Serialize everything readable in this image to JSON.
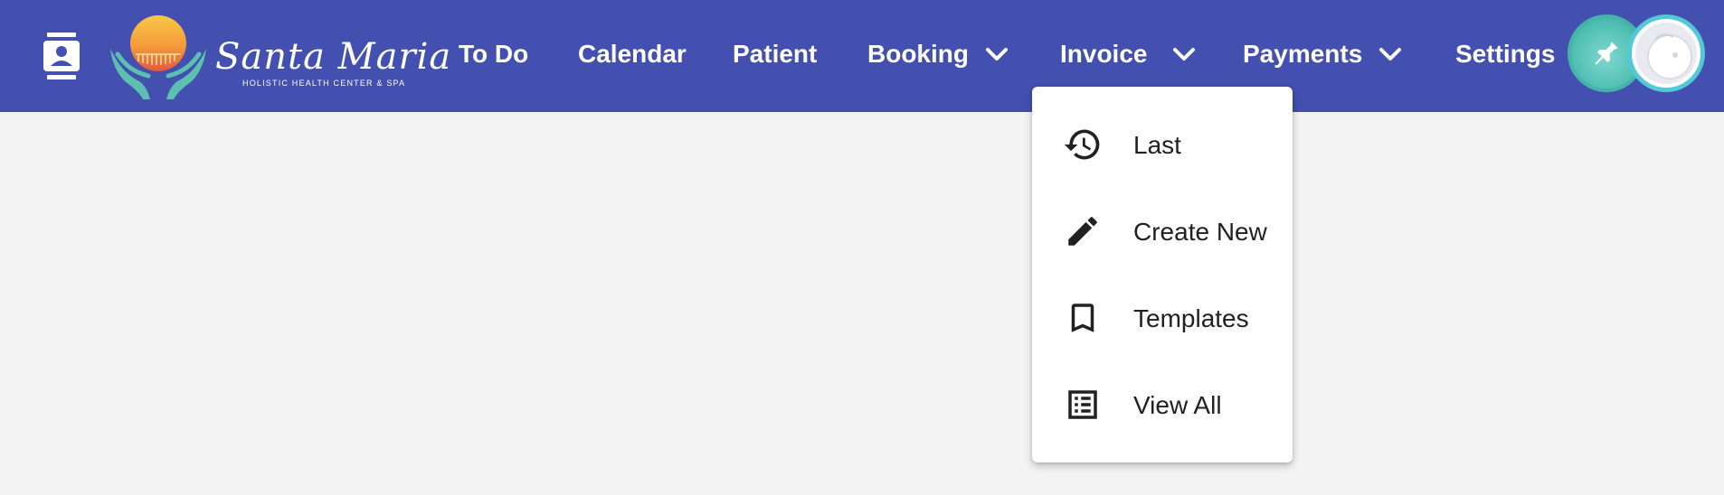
{
  "brand": {
    "name": "Santa Maria",
    "tagline": "HOLISTIC HEALTH CENTER & SPA"
  },
  "colors": {
    "topbar": "#4350b0",
    "background": "#f4f4f4",
    "menu_text": "#212121",
    "pin_button": "#52c0b4",
    "avatar_ring": "#53c8d6"
  },
  "nav": {
    "items": [
      {
        "label": "To Do",
        "has_dropdown": false
      },
      {
        "label": "Calendar",
        "has_dropdown": false
      },
      {
        "label": "Patient",
        "has_dropdown": false
      },
      {
        "label": "Booking",
        "has_dropdown": true
      },
      {
        "label": "Invoice",
        "has_dropdown": true
      },
      {
        "label": "Payments",
        "has_dropdown": true
      },
      {
        "label": "Settings",
        "has_dropdown": false
      }
    ]
  },
  "icons": {
    "contact": "contact-card-icon",
    "pin": "pin-icon",
    "avatar": "user-avatar",
    "chevron": "chevron-down-icon"
  },
  "invoice_menu": {
    "open": true,
    "items": [
      {
        "label": "Last",
        "icon": "history-icon"
      },
      {
        "label": "Create New",
        "icon": "pencil-icon"
      },
      {
        "label": "Templates",
        "icon": "bookmark-icon"
      },
      {
        "label": "View All",
        "icon": "list-icon"
      }
    ]
  }
}
